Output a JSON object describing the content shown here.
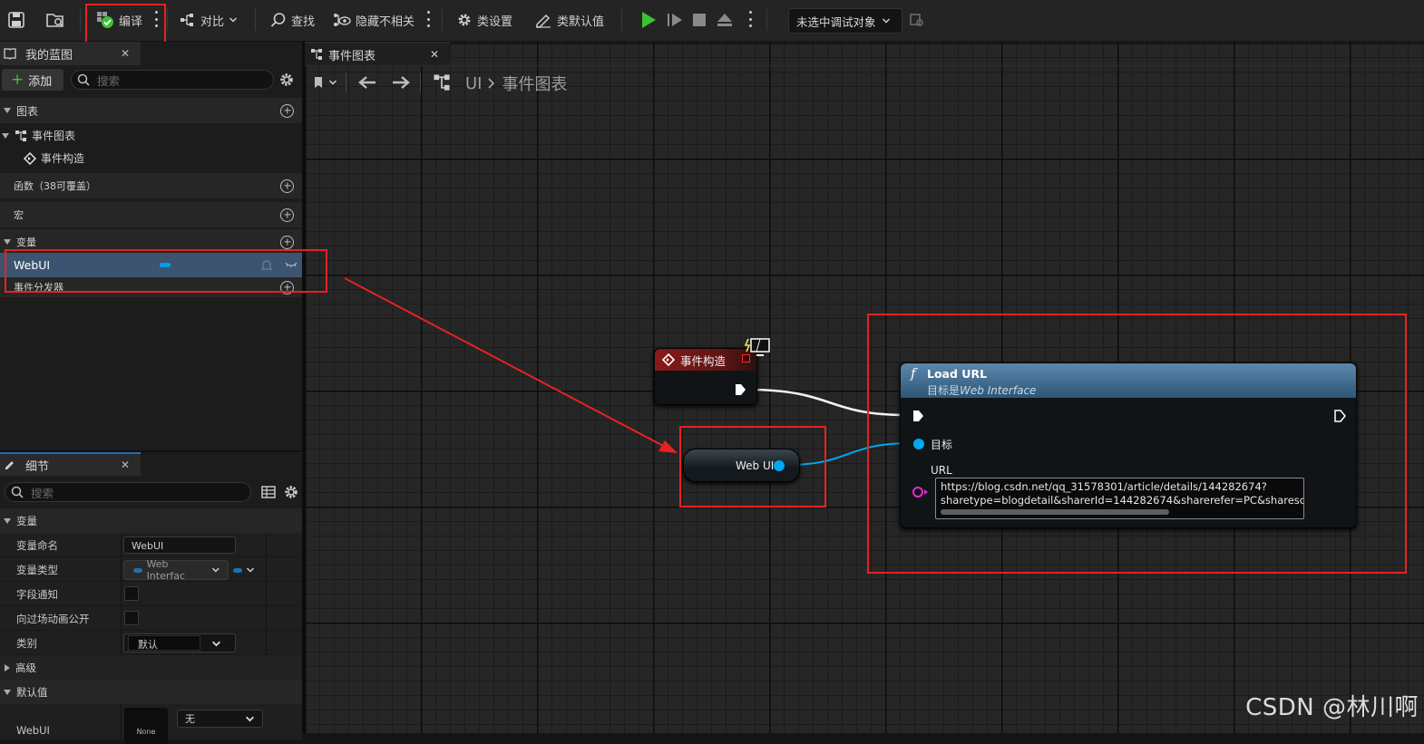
{
  "toolbar": {
    "compile": "编译",
    "diff": "对比",
    "find": "查找",
    "hide_unrelated": "隐藏不相关",
    "class_settings": "类设置",
    "class_defaults": "类默认值",
    "debug_target": "未选中调试对象"
  },
  "my_blueprint": {
    "title": "我的蓝图",
    "add_label": "添加",
    "search_placeholder": "搜索",
    "sections": {
      "graphs": "图表",
      "functions": "函数（38可覆盖）",
      "macros": "宏",
      "variables": "变量",
      "dispatchers": "事件分发器"
    },
    "graph_items": [
      "事件图表",
      "事件构造"
    ],
    "variable_items": [
      {
        "name": "WebUI",
        "type_color": "#00a0f0"
      }
    ]
  },
  "details": {
    "title": "细节",
    "search_placeholder": "搜索",
    "section_variable": "变量",
    "rows": {
      "var_name_label": "变量命名",
      "var_name_value": "WebUI",
      "var_type_label": "变量类型",
      "var_type_value": "Web Interfac",
      "field_notify_label": "字段通知",
      "expose_cinematics_label": "向过场动画公开",
      "category_label": "类别",
      "category_value": "默认"
    },
    "section_advanced": "高级",
    "section_default": "默认值",
    "default_row_label": "WebUI",
    "default_thumb": "None",
    "default_value": "无"
  },
  "graph": {
    "tab_title": "事件图表",
    "breadcrumb_root": "UI",
    "breadcrumb_current": "事件图表",
    "event_node_title": "事件构造",
    "var_node_label": "Web UI",
    "func_node_title": "Load URL",
    "func_node_subtitle_prefix": "目标是",
    "func_node_subtitle_target": "Web Interface",
    "pin_target": "目标",
    "pin_url": "URL",
    "url_line1": "https://blog.csdn.net/qq_31578301/article/details/144282674?",
    "url_line2": "sharetype=blogdetail&sharerId=144282674&sharerefer=PC&sharesou"
  },
  "watermark": "CSDN @林川啊",
  "colors": {
    "annotation_red": "#e52222",
    "object_pin": "#00a8f3",
    "string_pin": "#e62ad0",
    "exec_wire": "#ffffff",
    "event_header": "#8a1a1a",
    "function_header": "#3d6f95",
    "play_green": "#3cc230"
  }
}
